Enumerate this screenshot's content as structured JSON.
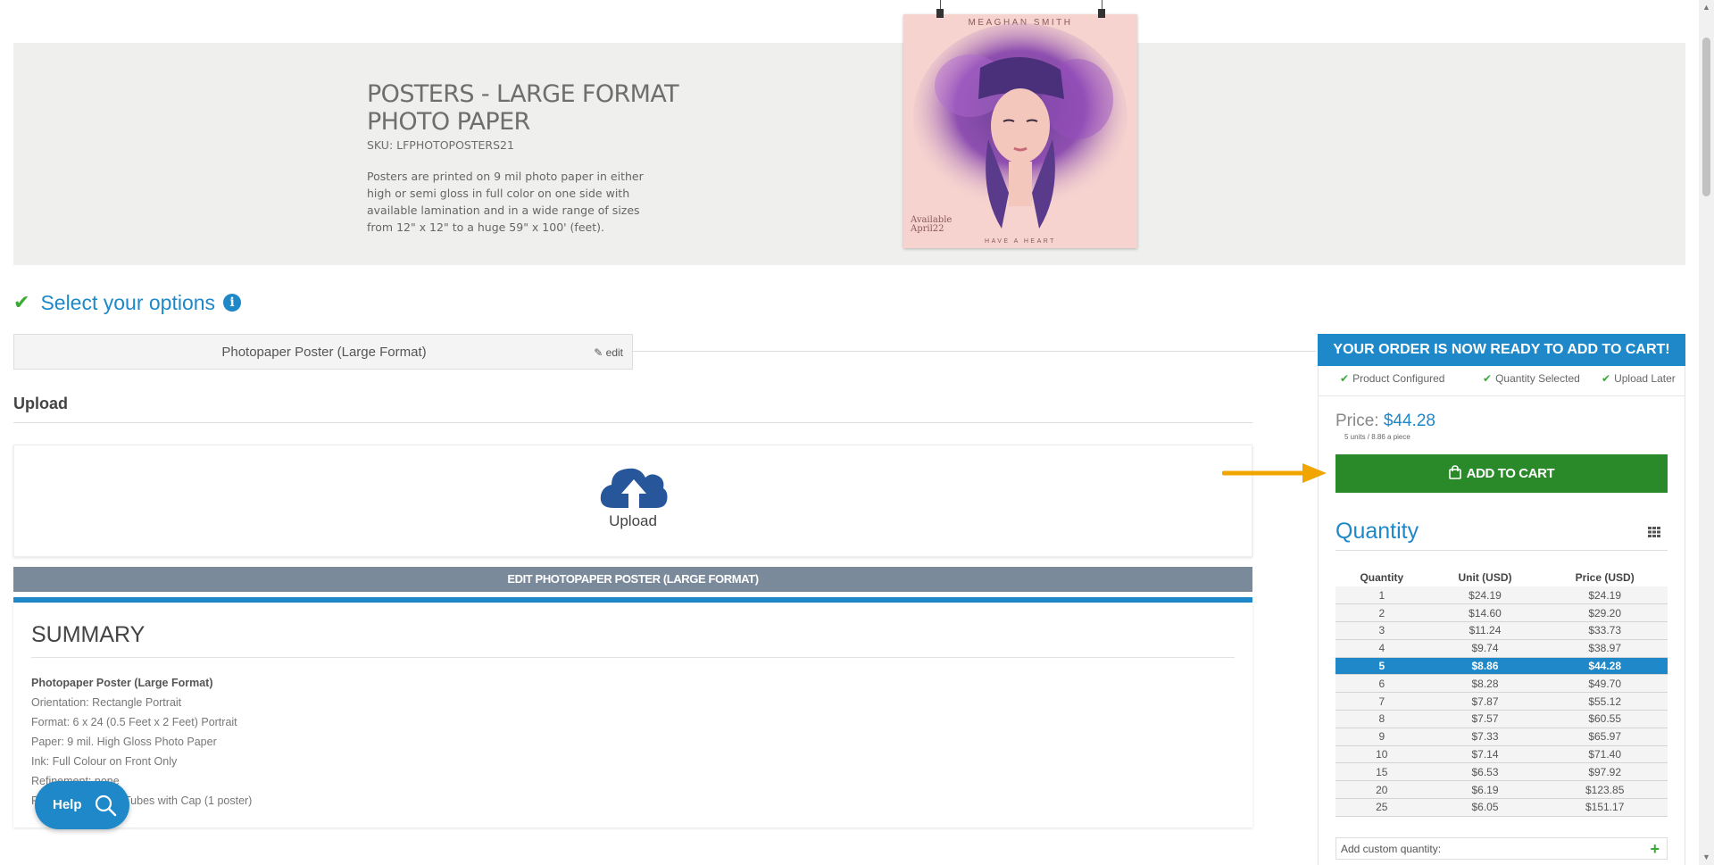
{
  "product": {
    "title": "POSTERS - LARGE FORMAT PHOTO PAPER",
    "sku": "SKU: LFPHOTOPOSTERS21",
    "description": "Posters are printed on 9 mil photo paper in either high or semi gloss in full color on one side with available lamination and in a wide range of sizes from 12\" x 12\" to a huge 59\" x 100' (feet).",
    "poster": {
      "artist": "MEAGHAN SMITH",
      "tagline": "HAVE A HEART",
      "available_line1": "Available",
      "available_line2": "April22"
    }
  },
  "options": {
    "heading": "Select your options",
    "selected_product": "Photopaper Poster (Large Format)",
    "edit_label": "edit"
  },
  "upload": {
    "heading": "Upload",
    "button_label": "Upload"
  },
  "edit_bar": "EDIT PHOTOPAPER POSTER (LARGE FORMAT)",
  "summary": {
    "title": "SUMMARY",
    "product": "Photopaper Poster (Large Format)",
    "orientation": "Orientation: Rectangle Portrait",
    "format": "Format: 6 x 24 (0.5 Feet x 2 Feet) Portrait",
    "paper": "Paper: 9 mil. High Gloss Photo Paper",
    "ink": "Ink: Full Colour on Front Only",
    "refinement": "Refinement: none",
    "packaging": "Packaging: Brown Tubes with Cap (1 poster)"
  },
  "help": {
    "label": "Help"
  },
  "order": {
    "banner": "YOUR ORDER IS NOW READY TO ADD TO CART!",
    "status": [
      "Product Configured",
      "Quantity Selected",
      "Upload Later"
    ],
    "price_label": "Price:",
    "price_value": "$44.28",
    "price_sub": "5 units / 8.86 a piece",
    "add_to_cart": "ADD TO CART"
  },
  "quantity": {
    "title": "Quantity",
    "headers": [
      "Quantity",
      "Unit (USD)",
      "Price (USD)"
    ],
    "selected_index": 4,
    "rows": [
      [
        "1",
        "$24.19",
        "$24.19"
      ],
      [
        "2",
        "$14.60",
        "$29.20"
      ],
      [
        "3",
        "$11.24",
        "$33.73"
      ],
      [
        "4",
        "$9.74",
        "$38.97"
      ],
      [
        "5",
        "$8.86",
        "$44.28"
      ],
      [
        "6",
        "$8.28",
        "$49.70"
      ],
      [
        "7",
        "$7.87",
        "$55.12"
      ],
      [
        "8",
        "$7.57",
        "$60.55"
      ],
      [
        "9",
        "$7.33",
        "$65.97"
      ],
      [
        "10",
        "$7.14",
        "$71.40"
      ],
      [
        "15",
        "$6.53",
        "$97.92"
      ],
      [
        "20",
        "$6.19",
        "$123.85"
      ],
      [
        "25",
        "$6.05",
        "$151.17"
      ]
    ],
    "custom_placeholder": "Add custom quantity:"
  },
  "colors": {
    "accent_blue": "#1e88c8",
    "cart_green": "#2a8a2a",
    "check_green": "#3aaa35",
    "arrow_orange": "#f0a500",
    "edit_bar_gray": "#7b8a9a"
  },
  "icons": [
    "check-icon",
    "info-icon",
    "pencil-icon",
    "cloud-upload-icon",
    "shopping-bag-icon",
    "grid-icon",
    "plus-icon",
    "search-icon",
    "arrow-right-icon"
  ]
}
